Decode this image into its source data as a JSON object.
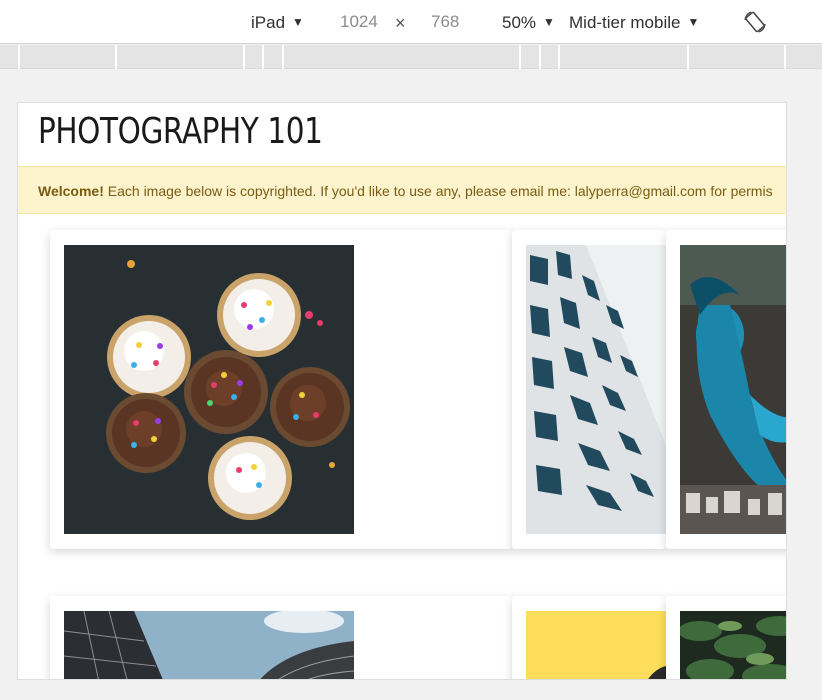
{
  "toolbar": {
    "device": "iPad",
    "width": "1024",
    "separator": "×",
    "height": "768",
    "zoom": "50%",
    "throttle": "Mid-tier mobile",
    "caret": "▼",
    "rotate_icon": "rotate-icon"
  },
  "page": {
    "title": "PHOTOGRAPHY 101",
    "welcome_bold": "Welcome!",
    "welcome_text": " Each image below is copyrighted. If you'd like to use any, please email me: lalyperra@gmail.com for permis"
  },
  "gallery": {
    "items": [
      {
        "subject": "cupcakes with sprinkles"
      },
      {
        "subject": "white building facade"
      },
      {
        "subject": "blue mermaid graffiti"
      },
      {
        "subject": "skyscrapers from below"
      },
      {
        "subject": "yellow wall"
      },
      {
        "subject": "palm trees"
      }
    ]
  },
  "colors": {
    "welcome_bg": "#fdf3cc",
    "welcome_text": "#7a5b12",
    "toolbar_bg": "#ffffff"
  }
}
